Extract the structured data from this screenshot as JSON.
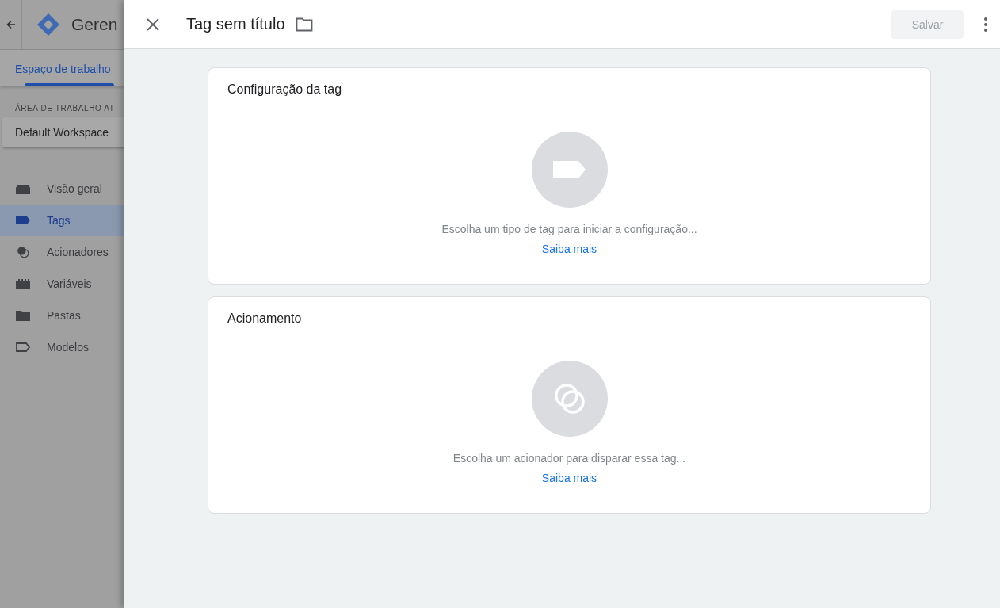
{
  "background_app": {
    "title": "Geren",
    "tabs": [
      {
        "label": "Espaço de trabalho",
        "selected": true
      }
    ],
    "workspace_label": "ÁREA DE TRABALHO AT",
    "workspace": "Default Workspace",
    "nav": [
      {
        "label": "Visão geral",
        "kind": "overview",
        "selected": false
      },
      {
        "label": "Tags",
        "kind": "tag",
        "selected": true
      },
      {
        "label": "Acionadores",
        "kind": "trigger",
        "selected": false
      },
      {
        "label": "Variáveis",
        "kind": "variable",
        "selected": false
      },
      {
        "label": "Pastas",
        "kind": "folder",
        "selected": false
      },
      {
        "label": "Modelos",
        "kind": "template",
        "selected": false
      }
    ]
  },
  "editor": {
    "title": "Tag sem título",
    "save": {
      "label": "Salvar",
      "disabled": true
    },
    "cards": [
      {
        "title": "Configuração da tag",
        "kind": "tag",
        "prompt": "Escolha um tipo de tag para iniciar a configuração...",
        "link": "Saiba mais"
      },
      {
        "title": "Acionamento",
        "kind": "trigger",
        "prompt": "Escolha um acionador para disparar essa tag...",
        "link": "Saiba mais"
      }
    ]
  }
}
